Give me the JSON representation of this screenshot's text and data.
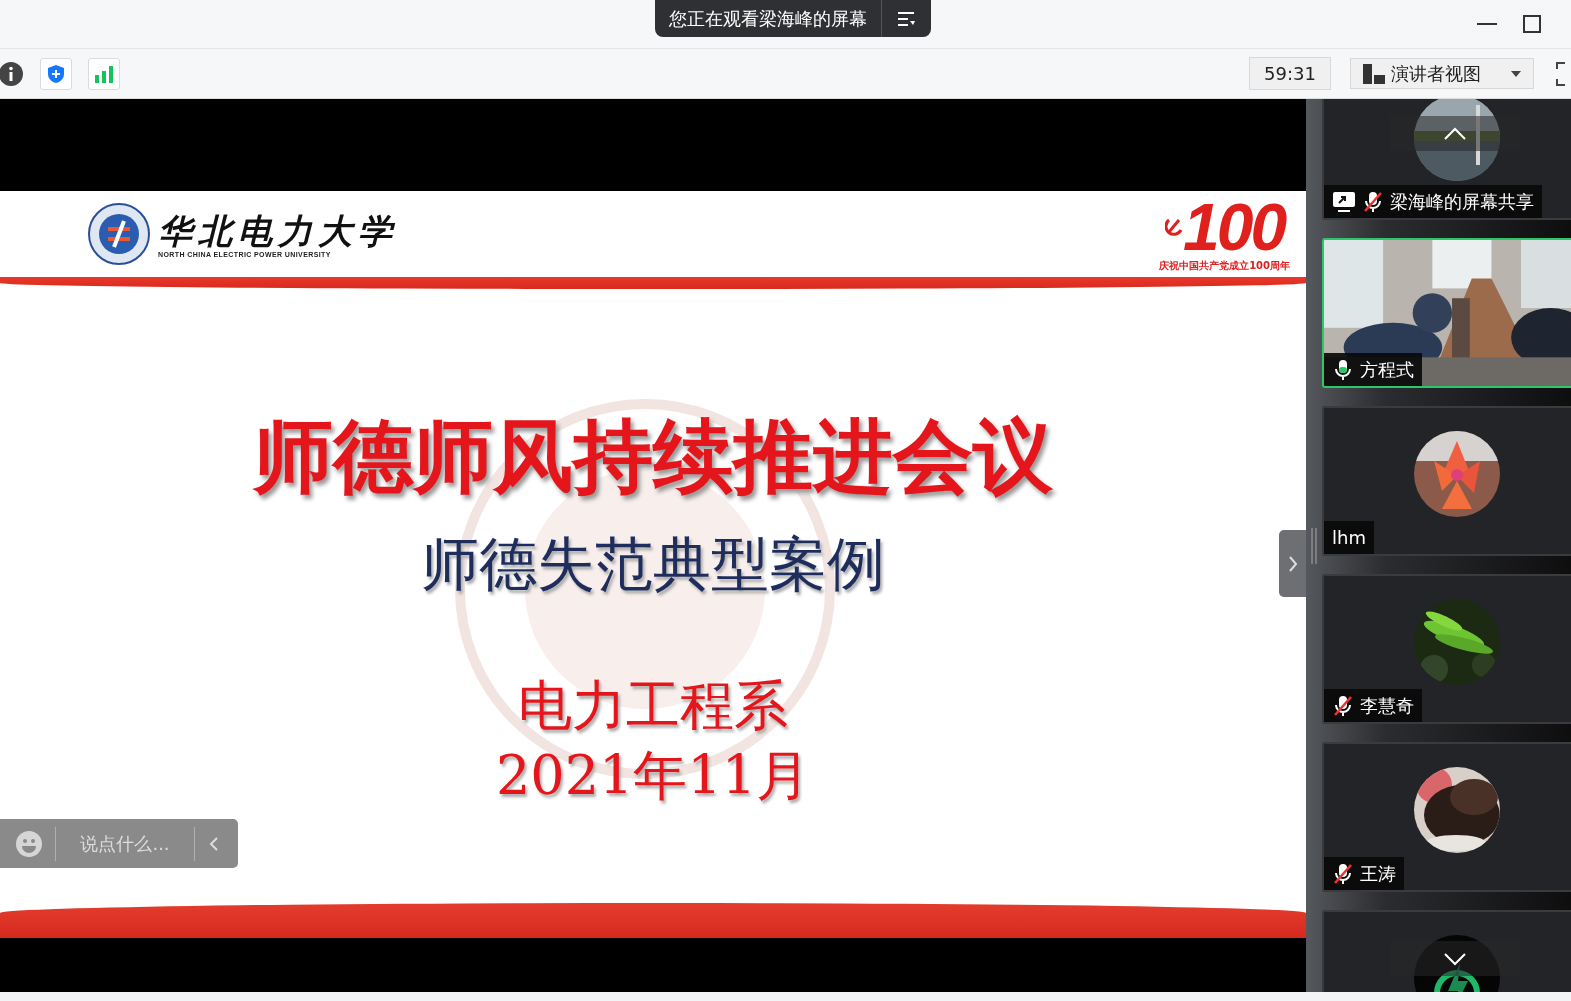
{
  "window": {
    "banner": "您正在观看梁海峰的屏幕"
  },
  "toolbar": {
    "timer": "59:31",
    "view_menu": "演讲者视图"
  },
  "slide": {
    "university_name": "华北电力大学",
    "university_name_en": "NORTH CHINA ELECTRIC POWER UNIVERSITY",
    "anniversary_number": "100",
    "anniversary_caption": "庆祝中国共产党成立100周年",
    "title": "师德师风持续推进会议",
    "subtitle": "师德失范典型案例",
    "department": "电力工程系",
    "date": "2021年11月"
  },
  "chat": {
    "placeholder": "说点什么..."
  },
  "participants": [
    {
      "name": "梁海峰的屏幕共享",
      "kind": "avatar",
      "sharing": true,
      "muted": true,
      "speaking": false
    },
    {
      "name": "方程式",
      "kind": "video",
      "sharing": false,
      "muted": false,
      "speaking": true
    },
    {
      "name": "lhm",
      "kind": "avatar",
      "sharing": false,
      "muted": false,
      "speaking": false
    },
    {
      "name": "李慧奇",
      "kind": "avatar",
      "sharing": false,
      "muted": true,
      "speaking": false
    },
    {
      "name": "王涛",
      "kind": "avatar",
      "sharing": false,
      "muted": true,
      "speaking": false
    },
    {
      "kind": "avatar",
      "speaking": false
    }
  ]
}
